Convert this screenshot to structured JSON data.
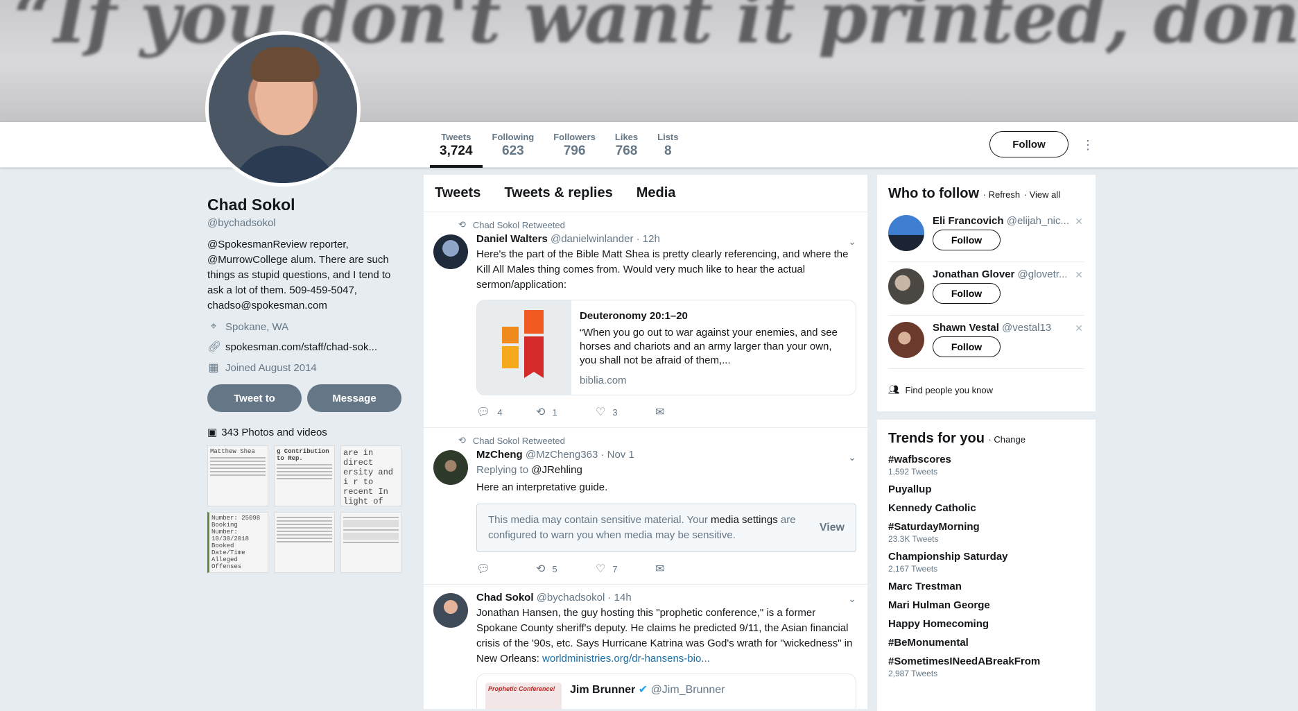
{
  "banner": {
    "text": "“If you don't want it printed, don't let it happen.”"
  },
  "stats": [
    {
      "label": "Tweets",
      "value": "3,724"
    },
    {
      "label": "Following",
      "value": "623"
    },
    {
      "label": "Followers",
      "value": "796"
    },
    {
      "label": "Likes",
      "value": "768"
    },
    {
      "label": "Lists",
      "value": "8"
    }
  ],
  "follow_label": "Follow",
  "profile": {
    "name": "Chad Sokol",
    "handle": "@bychadsokol",
    "bio_link1": "@SpokesmanReview",
    "bio_text1": " reporter,",
    "bio_link2": "@MurrowCollege",
    "bio_text2": " alum. There are such things as stupid questions, and I tend to ask a lot of them. 509-459-5047, chadso@spokesman.com",
    "location": "Spokane, WA",
    "url": "spokesman.com/staff/chad-sok...",
    "joined": "Joined August 2014",
    "tweet_to": "Tweet to",
    "message": "Message",
    "photos_label": "343 Photos and videos"
  },
  "photos": [
    {
      "text": "Matthew Shea"
    },
    {
      "text": "g Contribution to Rep."
    },
    {
      "text": "are in direct ersity and i r to recent In light of contribution."
    },
    {
      "text": "Number: 25098 Booking Number: 10/30/2018 Booked Date/Time Alleged Offenses"
    },
    {
      "text": ""
    },
    {
      "text": ""
    }
  ],
  "feed_tabs": [
    "Tweets",
    "Tweets & replies",
    "Media"
  ],
  "tweets": [
    {
      "retweet_label": "Chad Sokol Retweeted",
      "name": "Daniel Walters",
      "handle": "@danielwinlander",
      "time": "· 12h",
      "text": "Here's the part of the Bible Matt Shea is pretty clearly referencing, and where the Kill All Males thing comes from. Would very much like to hear the actual sermon/application:",
      "card_title": "Deuteronomy 20:1–20",
      "card_desc": "“When you go out to war against your enemies, and see horses and chariots and an army larger than your own, you shall not be afraid of them,...",
      "card_domain": "biblia.com",
      "replies": "4",
      "retweets": "1",
      "likes": "3"
    },
    {
      "retweet_label": "Chad Sokol Retweeted",
      "name": "MzCheng",
      "handle": "@MzCheng363",
      "time": "· Nov 1",
      "replying": "Replying to ",
      "replying_to": "@JRehling",
      "text": "Here an interpretative guide.",
      "sensitive_text": "This media may contain sensitive material. Your ",
      "sensitive_link": "media settings",
      "sensitive_text2": " are configured to warn you when media may be sensitive.",
      "view": "View",
      "replies": "",
      "retweets": "5",
      "likes": "7"
    },
    {
      "name": "Chad Sokol",
      "handle": "@bychadsokol",
      "time": "· 14h",
      "text": "Jonathan Hansen, the guy hosting this \"prophetic conference,\" is a former Spokane County sheriff's deputy. He claims he predicted 9/11, the Asian financial crisis of the '90s, etc. Says Hurricane Katrina was God's wrath for \"wickedness\" in New Orleans: ",
      "link": "worldministries.org/dr-hansens-bio...",
      "quote_img_text": "Prophetic Conference!",
      "quote_name": "Jim Brunner",
      "quote_handle": "@Jim_Brunner"
    }
  ],
  "who_to_follow": {
    "title": "Who to follow",
    "refresh": "· Refresh",
    "view_all": "· View all",
    "users": [
      {
        "name": "Eli Francovich",
        "handle": "@elijah_nic..."
      },
      {
        "name": "Jonathan Glover",
        "handle": "@glovetr..."
      },
      {
        "name": "Shawn Vestal",
        "handle": "@vestal13"
      }
    ],
    "follow_label": "Follow",
    "find_people": "Find people you know"
  },
  "trends": {
    "title": "Trends for you",
    "change": "· Change",
    "items": [
      {
        "name": "#wafbscores",
        "count": "1,592 Tweets"
      },
      {
        "name": "Puyallup",
        "count": ""
      },
      {
        "name": "Kennedy Catholic",
        "count": ""
      },
      {
        "name": "#SaturdayMorning",
        "count": "23.3K Tweets"
      },
      {
        "name": "Championship Saturday",
        "count": "2,167 Tweets"
      },
      {
        "name": "Marc Trestman",
        "count": ""
      },
      {
        "name": "Mari Hulman George",
        "count": ""
      },
      {
        "name": "Happy Homecoming",
        "count": ""
      },
      {
        "name": "#BeMonumental",
        "count": ""
      },
      {
        "name": "#SometimesINeedABreakFrom",
        "count": "2,987 Tweets"
      }
    ]
  },
  "colors": {
    "link": "#1a6fa8",
    "muted": "#657786",
    "background": "#e6ecf0"
  }
}
